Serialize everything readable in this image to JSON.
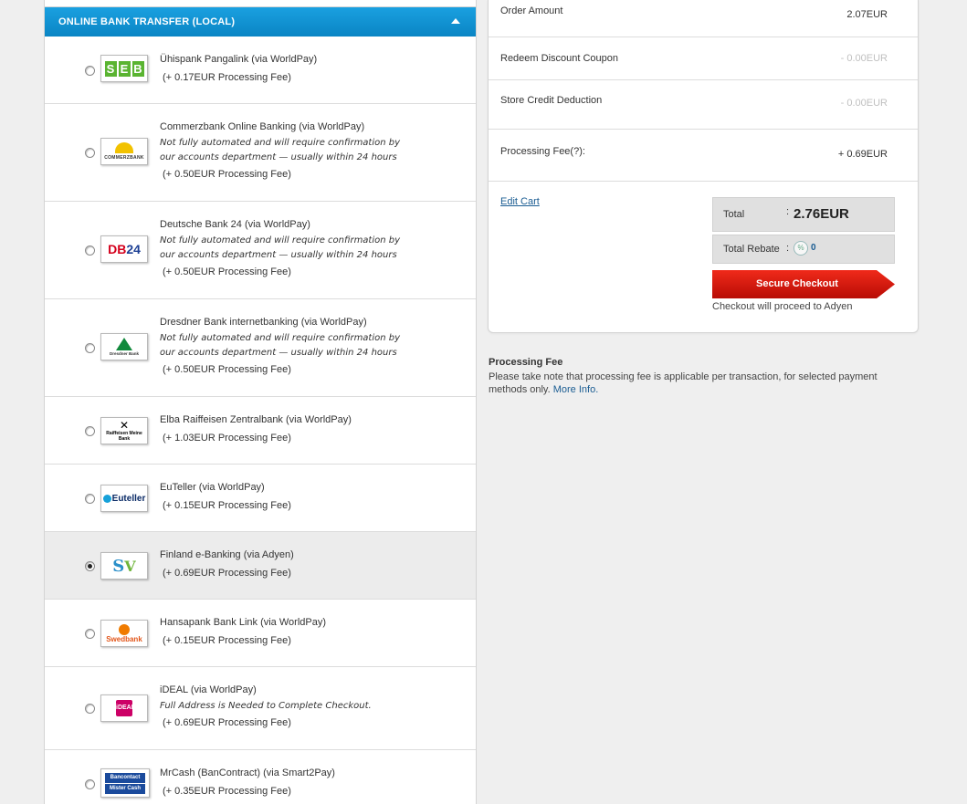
{
  "payment_section": {
    "title": "ONLINE BANK TRANSFER (LOCAL)",
    "methods": [
      {
        "name": "Ühispank Pangalink (via WorldPay)",
        "note": "",
        "fee": "(+ 0.17EUR Processing Fee)",
        "logo": "seb-logo",
        "selected": false
      },
      {
        "name": "Commerzbank Online Banking (via WorldPay)",
        "note": "Not fully automated and will require confirmation by our accounts department — usually within 24 hours",
        "fee": "(+ 0.50EUR Processing Fee)",
        "logo": "commerzbank-logo",
        "logo_text": "COMMERZBANK",
        "selected": false
      },
      {
        "name": "Deutsche Bank 24 (via WorldPay)",
        "note": "Not fully automated and will require confirmation by our accounts department — usually within 24 hours",
        "fee": "(+ 0.50EUR Processing Fee)",
        "logo": "db24-logo",
        "selected": false
      },
      {
        "name": "Dresdner Bank internetbanking (via WorldPay)",
        "note": "Not fully automated and will require confirmation by our accounts department — usually within 24 hours",
        "fee": "(+ 0.50EUR Processing Fee)",
        "logo": "dresdner-logo",
        "logo_text": "Dresdner Bank",
        "selected": false
      },
      {
        "name": "Elba Raiffeisen Zentralbank (via WorldPay)",
        "note": "",
        "fee": "(+ 1.03EUR Processing Fee)",
        "logo": "raiffeisen-logo",
        "logo_text": "Raiffeisen Meine Bank",
        "selected": false
      },
      {
        "name": "EuTeller (via WorldPay)",
        "note": "",
        "fee": "(+ 0.15EUR Processing Fee)",
        "logo": "euteller-logo",
        "logo_text": "Euteller",
        "selected": false
      },
      {
        "name": "Finland e-Banking (via Adyen)",
        "note": "",
        "fee": "(+ 0.69EUR Processing Fee)",
        "logo": "finland-ebanking-logo",
        "selected": true
      },
      {
        "name": "Hansapank Bank Link (via WorldPay)",
        "note": "",
        "fee": "(+ 0.15EUR Processing Fee)",
        "logo": "swedbank-logo",
        "logo_text": "Swedbank",
        "selected": false
      },
      {
        "name": "iDEAL (via WorldPay)",
        "note": "Full Address is Needed to Complete Checkout.",
        "fee": "(+ 0.69EUR Processing Fee)",
        "logo": "ideal-logo",
        "logo_text": "iDEAL",
        "selected": false
      },
      {
        "name": "MrCash (BanContract) (via Smart2Pay)",
        "note": "",
        "fee": "(+ 0.35EUR Processing Fee)",
        "logo": "mrcash-logo",
        "logo_text": "Bancontact Mister Cash",
        "selected": false
      }
    ]
  },
  "summary": {
    "order_amount_label": "Order Amount",
    "order_amount_value": "2.07EUR",
    "coupon_label": "Redeem Discount Coupon",
    "coupon_value": "- 0.00EUR",
    "store_credit_label": "Store Credit Deduction",
    "store_credit_value": "- 0.00EUR",
    "processing_fee_label": "Processing Fee(?):",
    "processing_fee_value": "+ 0.69EUR",
    "edit_cart_label": "Edit Cart",
    "total_label": "Total",
    "total_sep": ":",
    "total_value": "2.76EUR",
    "rebate_label": "Total Rebate",
    "rebate_sep": ":",
    "rebate_value": "0",
    "checkout_label": "Secure Checkout",
    "proceed_note": "Checkout will proceed to Adyen"
  },
  "processing_info": {
    "title": "Processing Fee",
    "text": "Please take note that processing fee is applicable per transaction, for selected payment methods only.",
    "link": "More Info."
  },
  "colors": {
    "header_blue": "#0a85c4",
    "checkout_red": "#d21b0e",
    "link_blue": "#1a5c92"
  }
}
